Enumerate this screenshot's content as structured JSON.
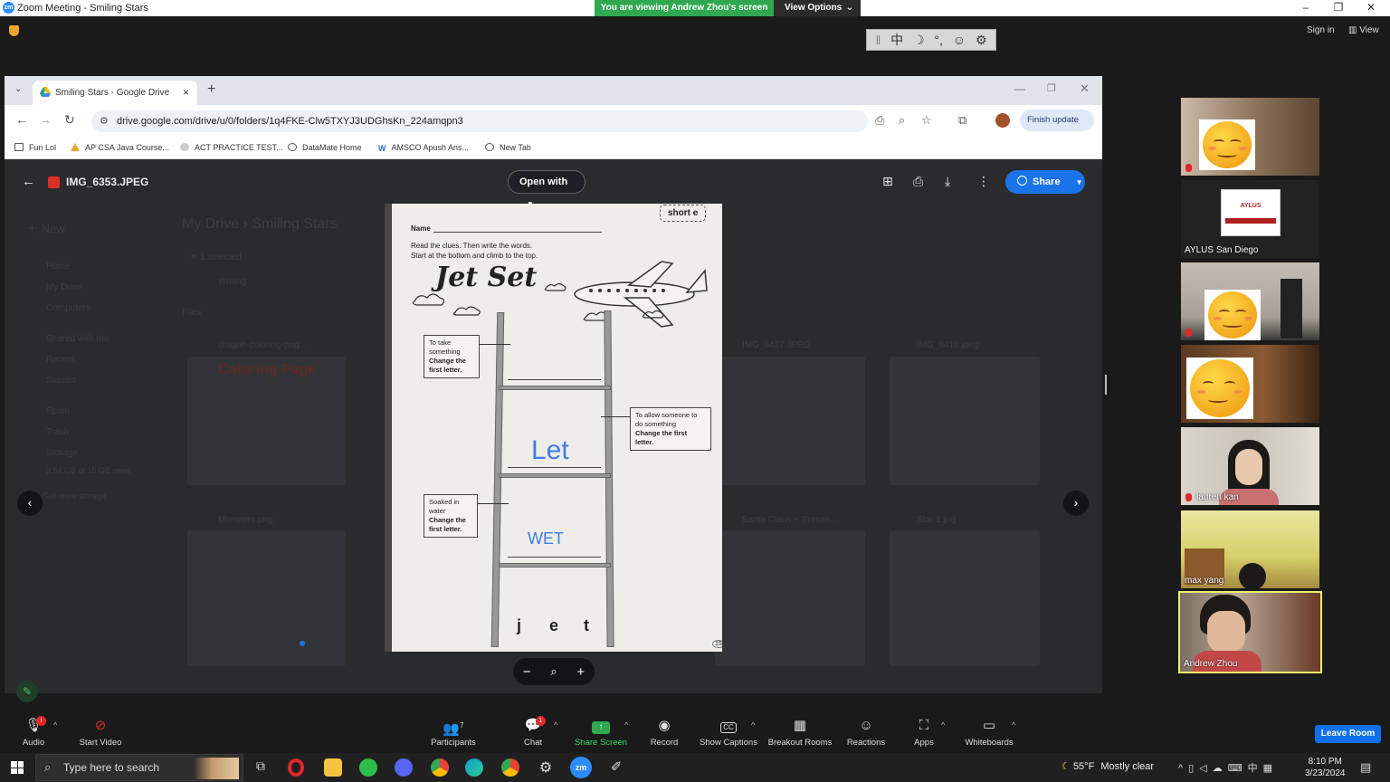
{
  "zoom": {
    "window_title": "Zoom Meeting - Smiling Stars",
    "logo_text": "zm",
    "viewing_banner": "You are viewing Andrew Zhou's screen",
    "view_options": "View Options",
    "sign_in": "Sign in",
    "view": "View"
  },
  "ime": [
    "中",
    "☽",
    "°,",
    "☺",
    "⚙"
  ],
  "chrome": {
    "tab_title": "Smiling Stars - Google Drive",
    "url": "drive.google.com/drive/u/0/folders/1q4FKE-Clw5TXYJ3UDGhsKn_224amqpn3",
    "finish_update": "Finish update",
    "bookmarks": [
      "Fun Lol",
      "AP CSA Java Course...",
      "ACT PRACTICE TEST...",
      "DataMate Home",
      "AMSCO Apush Ans...",
      "New Tab"
    ]
  },
  "drive": {
    "file_name": "IMG_6353.JPEG",
    "open_with": "Open with",
    "share": "Share",
    "bg": {
      "new": "New",
      "my_drive": "My Drive",
      "smiling_stars": "Smiling Stars",
      "selected": "1 selected",
      "nav": [
        "Home",
        "My Drive",
        "Computers",
        "Shared with me",
        "Recent",
        "Starred",
        "Spam",
        "Trash",
        "Storage"
      ],
      "folder": "Writing",
      "files": "Files",
      "file_names": [
        "dragon-coloring-pag...",
        "IMG_6427.JPEG",
        "IMG_6410.jpeg",
        "Monsters.png",
        "Santa Claus + Presen...",
        "Star 1.jpg"
      ],
      "storage": "3.54 GB of 15 GB used",
      "get_storage": "Get more storage",
      "coloring_page": "Coloring Page"
    }
  },
  "worksheet": {
    "tag": "short e",
    "name_label": "Name",
    "instructions_1": "Read the clues. Then write the words.",
    "instructions_2": "Start at the bottom and climb to the top.",
    "title": "Jet Set",
    "clue_top_1": "To take something",
    "clue_top_2": "Change the first letter.",
    "clue_mid_1": "To allow someone to do something",
    "clue_mid_2": "Change the first letter.",
    "clue_bot_1": "Soaked in water",
    "clue_bot_2": "Change the first letter.",
    "answer_let": "Let",
    "answer_wet": "WET",
    "base_letters": [
      "j",
      "e",
      "t"
    ],
    "page_num": "15"
  },
  "gallery": [
    {
      "name": "",
      "emoji": true
    },
    {
      "name": "AYLUS San Diego",
      "logo_text": "AYLUS"
    },
    {
      "name": "",
      "emoji": true
    },
    {
      "name": "",
      "emoji": true
    },
    {
      "name": "lauren kan"
    },
    {
      "name": "max yang"
    },
    {
      "name": "Andrew Zhou",
      "active": true
    }
  ],
  "toolbar": {
    "audio": "Audio",
    "audio_badge": "!",
    "start_video": "Start Video",
    "participants": "Participants",
    "participants_count": "7",
    "chat": "Chat",
    "chat_badge": "1",
    "share_screen": "Share Screen",
    "record": "Record",
    "captions": "Show Captions",
    "captions_icon": "CC",
    "breakout": "Breakout Rooms",
    "reactions": "Reactions",
    "apps": "Apps",
    "whiteboards": "Whiteboards",
    "leave": "Leave Room"
  },
  "taskbar": {
    "search_placeholder": "Type here to search",
    "temp": "55°F",
    "weather": "Mostly clear",
    "time": "8:10 PM",
    "date": "3/23/2024",
    "ime_lang": "中"
  },
  "colors": {
    "zoom_green": "#2fa84f",
    "drive_blue": "#1a73e8",
    "leave_blue": "#0e71eb",
    "active_border": "#e9f06a",
    "answer_blue": "#3d7ee0"
  }
}
